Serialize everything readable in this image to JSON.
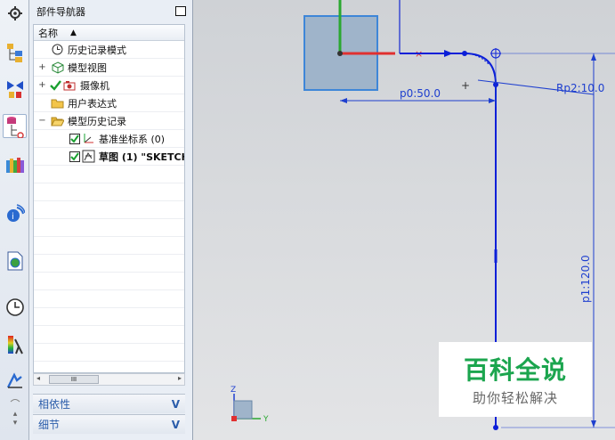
{
  "navigator": {
    "title": "部件导航器",
    "column_header": "名称",
    "items": [
      {
        "label": "历史记录模式",
        "icon": "clock-icon",
        "level": 1,
        "expander": ""
      },
      {
        "label": "模型视图",
        "icon": "model-views-icon",
        "level": 1,
        "expander": "+"
      },
      {
        "label": "摄像机",
        "icon": "camera-icon",
        "level": 1,
        "expander": "+"
      },
      {
        "label": "用户表达式",
        "icon": "folder-icon",
        "level": 1,
        "expander": ""
      },
      {
        "label": "模型历史记录",
        "icon": "folder-open-icon",
        "level": 1,
        "expander": "−"
      },
      {
        "label": "基准坐标系 (0)",
        "icon": "datum-csys-icon",
        "level": 2,
        "checked": true
      },
      {
        "label": "草图 (1) \"SKETCH",
        "icon": "sketch-icon",
        "level": 2,
        "checked": true
      }
    ],
    "scroll_thumb": "III",
    "panels": [
      {
        "label": "相依性"
      },
      {
        "label": "细节"
      }
    ]
  },
  "toolbar_icons": [
    "settings-gear-icon",
    "assembly-navigator-icon",
    "constraint-navigator-icon",
    "part-navigator-icon",
    "reuse-library-icon",
    "hd3d-tools-icon",
    "web-browser-icon",
    "history-icon",
    "system-materials-icon",
    "process-studio-icon"
  ],
  "graphics": {
    "dimensions": [
      "p0:50.0",
      "Rp2:10.0",
      "p1:120.0"
    ],
    "triad_labels": {
      "z": "Z",
      "y": "Y"
    },
    "axis_colors": {
      "x": "#e03030",
      "y": "#2aa830",
      "z": "#2040d0"
    },
    "sketch_color": "#0b1fd8",
    "dimension_color": "#1e3fcf"
  },
  "watermark": {
    "title": "百科全说",
    "subtitle": "助你轻松解决"
  }
}
